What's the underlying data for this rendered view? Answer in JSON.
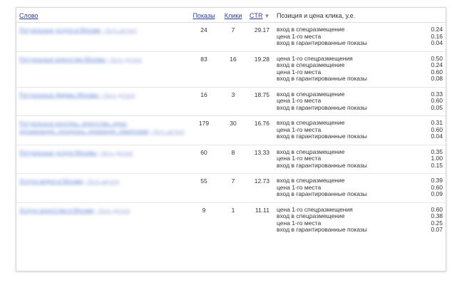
{
  "headers": {
    "word": "Слово",
    "shows": "Показы",
    "clicks": "Клики",
    "ctr": "CTR",
    "position": "Позиция и цена клика, у.е."
  },
  "rows": [
    {
      "keyword": "Ритуальные услуги в Москве",
      "keyword_extra": "› быть детали",
      "shows": "24",
      "clicks": "7",
      "ctr": "29.17",
      "positions": [
        {
          "label": "вход в спецразмещение",
          "price": "0.24"
        },
        {
          "label": "цена 1-го места",
          "price": "0.16"
        },
        {
          "label": "вход в гарантированные показы",
          "price": "0.04"
        }
      ]
    },
    {
      "keyword": "Ритуальные агентства Москвы",
      "keyword_extra": "› быть детали",
      "shows": "83",
      "clicks": "16",
      "ctr": "19.28",
      "positions": [
        {
          "label": "цена 1-го спецразмещения",
          "price": "0.50"
        },
        {
          "label": "вход в спецразмещение",
          "price": "0.24"
        },
        {
          "label": "цена 1-го места",
          "price": "0.60"
        },
        {
          "label": "вход в гарантированные показы",
          "price": "0.08"
        }
      ]
    },
    {
      "keyword": "Ритуальные фирмы Москвы",
      "keyword_extra": "› быть детали",
      "shows": "16",
      "clicks": "3",
      "ctr": "18.75",
      "positions": [
        {
          "label": "вход в спецразмещение",
          "price": "0.33"
        },
        {
          "label": "цена 1-го места",
          "price": "0.60"
        },
        {
          "label": "вход в гарантированные показы",
          "price": "0.05"
        }
      ]
    },
    {
      "keyword": "Ритуальные конторы, агентства, цены",
      "keyword_line2": "организация, похороны, кремация, памятники",
      "keyword_extra": "› быть детали",
      "shows": "179",
      "clicks": "30",
      "ctr": "16.76",
      "positions": [
        {
          "label": "вход в спецразмещение",
          "price": "0.31"
        },
        {
          "label": "цена 1-го места",
          "price": "0.60"
        },
        {
          "label": "вход в гарантированные показы",
          "price": "0.04"
        }
      ]
    },
    {
      "keyword": "Ритуальные услуги Москвы",
      "keyword_extra": "› быть детали",
      "shows": "60",
      "clicks": "8",
      "ctr": "13.33",
      "positions": [
        {
          "label": "вход в спецразмещение",
          "price": "0.35"
        },
        {
          "label": "цена 1-го места",
          "price": "1.00"
        },
        {
          "label": "вход в гарантированные показы",
          "price": "0.15"
        }
      ]
    },
    {
      "keyword": "Услуги морга в Москве",
      "keyword_extra": "› быть детали",
      "shows": "55",
      "clicks": "7",
      "ctr": "12.73",
      "positions": [
        {
          "label": "вход в спецразмещение",
          "price": "0.39"
        },
        {
          "label": "цена 1-го места",
          "price": "0.60"
        },
        {
          "label": "вход в гарантированные показы",
          "price": "0.09"
        }
      ]
    },
    {
      "keyword": "Услуги агентства в Москве",
      "keyword_extra": "› быть детали",
      "shows": "9",
      "clicks": "1",
      "ctr": "11.11",
      "positions": [
        {
          "label": "цена 1-го спецразмещения",
          "price": "0.60"
        },
        {
          "label": "вход в спецразмещение",
          "price": "0.38"
        },
        {
          "label": "цена 1-го места",
          "price": "0.25"
        },
        {
          "label": "вход в гарантированные показы",
          "price": "0.07"
        }
      ]
    }
  ],
  "icons": {
    "sort": "sort-desc-arrow-icon"
  }
}
